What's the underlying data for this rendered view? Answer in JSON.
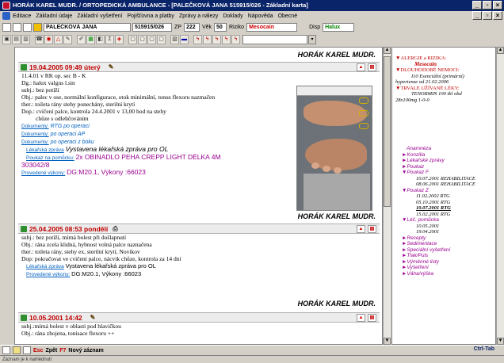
{
  "window": {
    "title": "HORÁK KAREL MUDR. / ORTOPEDICKÁ AMBULANCE - [PALEČKOVÁ JANA 515915/026 - Základní karta]",
    "buttons": [
      "_",
      "▫",
      "×"
    ]
  },
  "menu": {
    "items": [
      "Editace",
      "Základní údaje",
      "Základní vyšetření",
      "Pojišťovna a platby",
      "Zprávy a nálezy",
      "Doklady",
      "Nápověda",
      "Obecné"
    ]
  },
  "patient": {
    "name": "PALEČKOVÁ JANA",
    "id": "515915/026",
    "zp_label": "ZP",
    "zp": "222",
    "age_label": "Věk",
    "age": "50",
    "risk_label": "Riziko",
    "risk": "Mesocain",
    "disp_label": "Disp",
    "disp": "Halux"
  },
  "toolbar": {
    "icons": [
      "save-icon",
      "print-icon",
      "phone-icon",
      "stop-icon",
      "warning-icon",
      "edit-icon",
      "palette-icon",
      "chart-icon",
      "page-icon",
      "sigma-icon",
      "drug-icon",
      "doc-icon",
      "doc2-icon",
      "doc3-icon",
      "doc4-icon",
      "tag-icon",
      "list-icon",
      "tool-icon",
      "tool2-icon",
      "tool3-icon",
      "tool4-icon",
      "tool5-icon"
    ],
    "search_value": ""
  },
  "records": [
    {
      "doctor": "HORÁK KAREL MUDR.",
      "date": "19.04.2005 09:49 úterý",
      "lines": [
        "11.4.01 v RK op. sec B - K",
        "Dg.: halux valgus l.sin",
        "subj.: bez potíží",
        "Obj.: palec v ose, normální konfigurace, otok minimální, tonus flexoru nazmačen",
        "ther.: toileta rány stehy ponechány, sterilní krytí",
        "Dop.: cvičení palce, kontrola 24.4.2001 v 13,00 hod na stehy",
        "chůze s odlehčováním"
      ],
      "docs": [
        {
          "label": "Dokumenty:",
          "value": "RTG po operaci"
        },
        {
          "label": "Dokumenty:",
          "value": "po operaci AP"
        },
        {
          "label": "Dokumenty:",
          "value": "po operaci z boku"
        }
      ],
      "report_label": "Lékařská zpráva",
      "report_value": "Vystavena lékařská zpráva pro OL",
      "voucher_label": "Poukaz na pomůcku:",
      "voucher_value": "2x OBINADLO PEHA CREPP LIGHT DÉLKA 4M",
      "voucher_code": "303042/8",
      "perf_label": "Provedené výkony:",
      "perf_value": "DG:M20.1, Výkony :66023"
    },
    {
      "doctor": "HORÁK KAREL MUDR.",
      "date": "25.04.2005 08:53 pondělí",
      "lines": [
        "subj.: bez potíží, mírná bolest při došlapnutí",
        "Obj.: rána zcela klidná, hybnost volná palce naznačena",
        "ther.: toileta rány, stehy ex, sterilní krytí, Novikov",
        "Dop: pokračovat ve cvičení palce, nácvik chůze, kontrola za 14 dní"
      ],
      "report_label": "Lékařská zpráva",
      "report_value": "Vystavena lékařská zpráva pro OL",
      "perf_label": "Provedené výkony:",
      "perf_value": "DG:M20.1, Výkony :66023"
    },
    {
      "doctor": "HORÁK KAREL MUDR.",
      "date": "10.05.2001 14:42",
      "lines": [
        "subj.:mírná bolest v oblasti pod hlavičkou",
        "Obj.: rána zhojena, tonisace flexoru ++"
      ]
    }
  ],
  "right_panel": {
    "alergie_header": "▼ALERGIE a RIZIKA:",
    "alergie_value": "Mesocain",
    "dlouho_header": "▼DLOUHODOBÉ NEMOCI:",
    "dlouho_values": [
      "I10 Esenciální (primární)",
      "hypertenze od 21.02.2006"
    ],
    "trvale_header": "▼TRVALE UŽÍVANÉ LÉKY:",
    "trvale_values": [
      "TENORMIN 100 tbl obd",
      "28x100mg 1-0-0"
    ],
    "sections": [
      {
        "label": "Anamnéza",
        "items": []
      },
      {
        "label": "►Konzilia",
        "items": []
      },
      {
        "label": "►Lékařské zprávy",
        "items": []
      },
      {
        "label": "►Poukaz",
        "items": []
      },
      {
        "label": "▼Poukaz F",
        "items": [
          "10.07.2001 REHABILITACE",
          "08.06.2001 REHABILITACE"
        ]
      },
      {
        "label": "▼Poukaz Z",
        "items": [
          "11.02.2002 RTG",
          "05.10.2001 RTG",
          "10.07.2001 RTG",
          "15.02.2001 RTG"
        ]
      },
      {
        "label": "▼Léč. pomůcka",
        "items": [
          "10.05.2001",
          "19.04.2001"
        ]
      },
      {
        "label": "►Recepty",
        "items": []
      },
      {
        "label": "►Sedimentace",
        "items": []
      },
      {
        "label": "►Speciální vyšetření",
        "items": []
      },
      {
        "label": "►Tlak/Puls",
        "items": []
      },
      {
        "label": "►Výměnné listy",
        "items": []
      },
      {
        "label": "►Vyšetření",
        "items": []
      },
      {
        "label": "►Váha/výška",
        "items": []
      }
    ]
  },
  "statusbar": {
    "esc_label": "Esc",
    "zpet": "Zpět",
    "f7_label": "F7",
    "new_record": "Nový záznam",
    "ctrl_tab": "Ctrl-Tab",
    "bottom": "Záznam je k nahlédnutí"
  }
}
